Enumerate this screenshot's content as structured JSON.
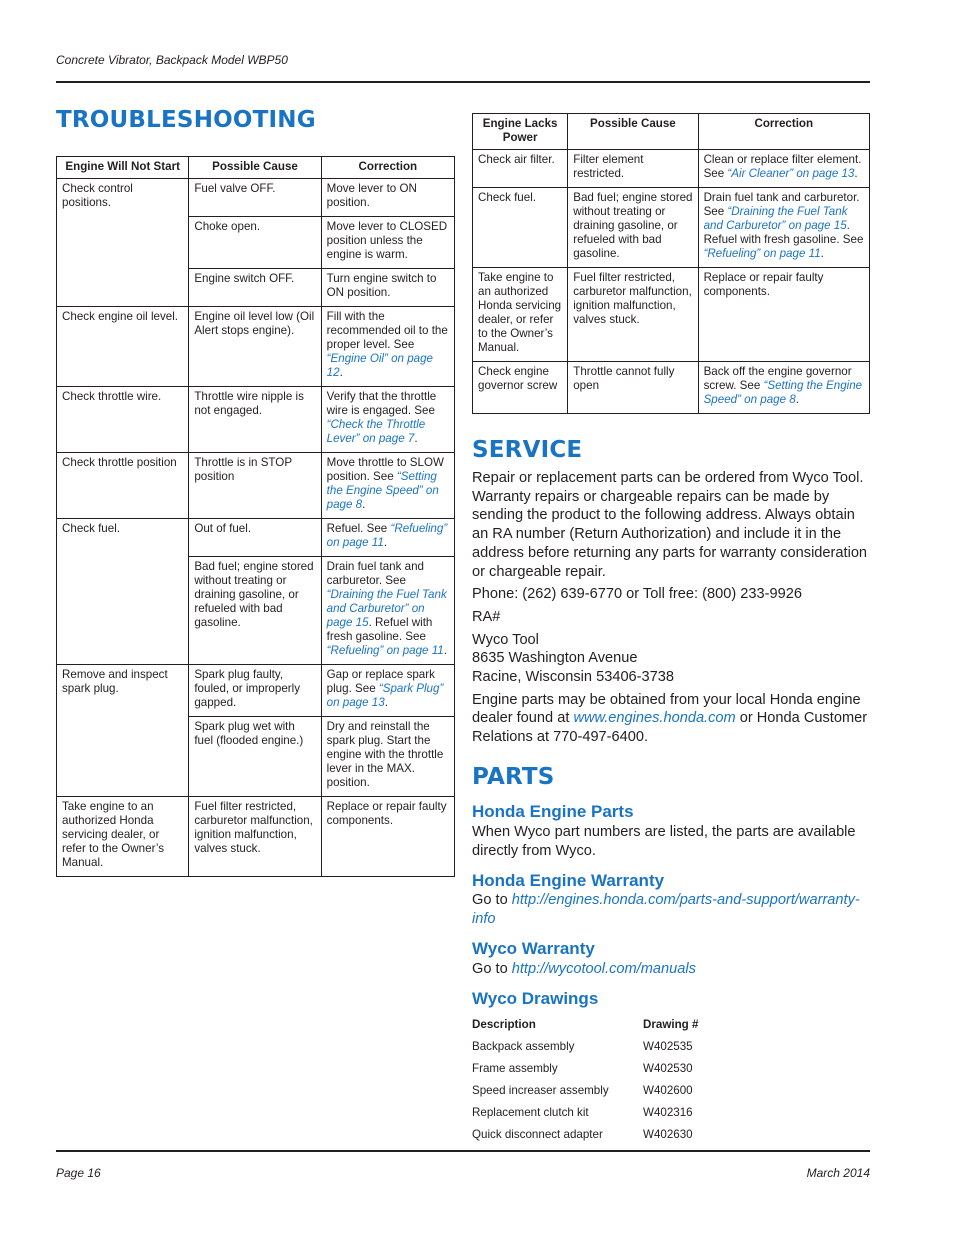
{
  "header": {
    "running_title": "Concrete Vibrator, Backpack Model WBP50"
  },
  "footer": {
    "page": "Page 16",
    "date": "March 2014"
  },
  "troubleshooting": {
    "title": "TROUBLESHOOTING",
    "engine_will_not_start": {
      "headers": [
        "Engine Will Not Start",
        "Possible Cause",
        "Correction"
      ],
      "groups": [
        {
          "check": "Check control positions.",
          "rows": [
            {
              "cause": "Fuel valve OFF.",
              "correction": "Move lever to ON position.",
              "link": "",
              "after": ""
            },
            {
              "cause": "Choke open.",
              "correction": "Move lever to CLOSED position unless the engine is warm.",
              "link": "",
              "after": ""
            },
            {
              "cause": "Engine switch OFF.",
              "correction": "Turn engine switch to ON position.",
              "link": "",
              "after": ""
            }
          ]
        },
        {
          "check": "Check engine oil level.",
          "rows": [
            {
              "cause": "Engine oil level low (Oil Alert stops engine).",
              "correction": "Fill with the recommended oil to the proper level. See ",
              "link": "“Engine Oil” on page 12",
              "after": "."
            }
          ]
        },
        {
          "check": "Check throttle wire.",
          "rows": [
            {
              "cause": "Throttle wire nipple is not engaged.",
              "correction": "Verify that the throttle wire is engaged. See ",
              "link": "“Check the Throttle Lever” on page 7",
              "after": "."
            }
          ]
        },
        {
          "check": "Check throttle position",
          "rows": [
            {
              "cause": "Throttle is in STOP position",
              "correction": "Move throttle to SLOW position. See ",
              "link": "“Setting the Engine Speed” on page 8",
              "after": "."
            }
          ]
        },
        {
          "check": "Check fuel.",
          "rows": [
            {
              "cause": "Out of fuel.",
              "correction": "Refuel. See ",
              "link": "“Refueling” on page 11",
              "after": "."
            },
            {
              "cause": "Bad fuel; engine stored without treating or draining gasoline, or refueled with bad gasoline.",
              "correction": "Drain fuel tank and carburetor. See ",
              "link": "“Draining the Fuel Tank and Carburetor” on page 15",
              "after": ". Refuel with fresh gasoline. See ",
              "link2": "“Refueling” on page 11",
              "after2": "."
            }
          ]
        },
        {
          "check": "Remove and inspect spark plug.",
          "rows": [
            {
              "cause": "Spark plug faulty, fouled, or improperly gapped.",
              "correction": "Gap or replace spark plug. See ",
              "link": "“Spark Plug” on page 13",
              "after": "."
            },
            {
              "cause": "Spark plug wet with fuel (flooded engine.)",
              "correction": "Dry and reinstall the spark plug. Start the engine with the throttle lever in the MAX. position.",
              "link": "",
              "after": ""
            }
          ]
        },
        {
          "check": "Take engine to an authorized Honda servicing dealer, or refer to the Owner’s Manual.",
          "rows": [
            {
              "cause": "Fuel filter restricted, carburetor malfunction, ignition malfunction, valves stuck.",
              "correction": "Replace or repair faulty components.",
              "link": "",
              "after": ""
            }
          ]
        }
      ]
    },
    "engine_lacks_power": {
      "headers": [
        "Engine Lacks Power",
        "Possible Cause",
        "Correction"
      ],
      "rows": [
        {
          "check": "Check air filter.",
          "cause": "Filter element restricted.",
          "correction": "Clean or replace filter element. See ",
          "link": "“Air Cleaner” on page 13",
          "after": "."
        },
        {
          "check": "Check fuel.",
          "cause": "Bad fuel; engine stored without treating or draining gasoline, or refueled with bad gasoline.",
          "correction": "Drain fuel tank and carburetor. See ",
          "link": "“Draining the Fuel Tank and Carburetor” on page 15",
          "after": ". Refuel with fresh gasoline. See ",
          "link2": "“Refueling” on page 11",
          "after2": "."
        },
        {
          "check": "Take engine to an authorized Honda servicing dealer, or refer to the Owner’s Manual.",
          "cause": "Fuel filter restricted, carburetor malfunction, ignition malfunction, valves stuck.",
          "correction": "Replace or repair faulty components.",
          "link": "",
          "after": ""
        },
        {
          "check": "Check engine governor screw",
          "cause": "Throttle cannot fully open",
          "correction": "Back off the engine governor screw. See ",
          "link": "“Setting the Engine Speed” on page 8",
          "after": "."
        }
      ]
    }
  },
  "service": {
    "title": "SERVICE",
    "intro": "Repair or replacement parts can be ordered from Wyco Tool. Warranty repairs or chargeable repairs can be made by sending the product to the following address. Always obtain an RA number (Return Authorization) and include it in the address before returning any parts for warranty consideration or chargeable repair.",
    "phone": "Phone: (262) 639-6770 or Toll free: (800) 233-9926",
    "ra": "RA#",
    "address": [
      "Wyco Tool",
      "8635 Washington Avenue",
      "Racine, Wisconsin 53406-3738"
    ],
    "honda_before": "Engine parts may be obtained from your local Honda engine dealer found at ",
    "honda_link": "www.engines.honda.com",
    "honda_after": " or Honda Customer Relations at 770-497-6400."
  },
  "parts": {
    "title": "PARTS",
    "honda_engine_parts": {
      "heading": "Honda Engine Parts",
      "text": "When Wyco part numbers are listed, the parts are available directly from Wyco."
    },
    "honda_engine_warranty": {
      "heading": "Honda Engine Warranty",
      "prefix": "Go to ",
      "link": "http://engines.honda.com/parts-and-support/warranty-info"
    },
    "wyco_warranty": {
      "heading": "Wyco Warranty",
      "prefix": "Go to ",
      "link": "http://wycotool.com/manuals"
    },
    "wyco_drawings": {
      "heading": "Wyco Drawings",
      "headers": [
        "Description",
        "Drawing #"
      ],
      "rows": [
        [
          "Backpack assembly",
          "W402535"
        ],
        [
          "Frame assembly",
          "W402530"
        ],
        [
          "Speed increaser assembly",
          "W402600"
        ],
        [
          "Replacement clutch kit",
          "W402316"
        ],
        [
          "Quick disconnect adapter",
          "W402630"
        ]
      ]
    }
  },
  "colors": {
    "accent": "#1a74c4",
    "text": "#231f20"
  }
}
